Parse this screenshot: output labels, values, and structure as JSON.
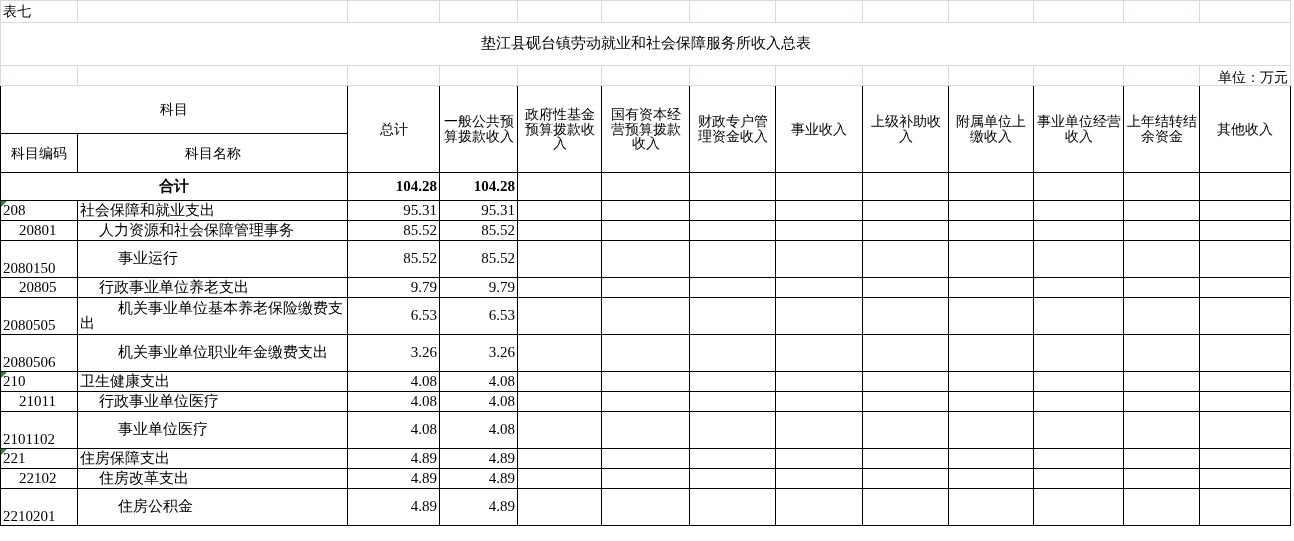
{
  "sheet_label": "表七",
  "title": "垫江县砚台镇劳动就业和社会保障服务所收入总表",
  "unit": "单位：万元",
  "table": {
    "group_header": "科目",
    "columns": [
      "科目编码",
      "科目名称",
      "总计",
      "一般公共预算拨款收入",
      "政府性基金预算拨款收入",
      "国有资本经营预算拨款收入",
      "财政专户管理资金收入",
      "事业收入",
      "上级补助收入",
      "附属单位上缴收入",
      "事业单位经营收入",
      "上年结转结余资金",
      "其他收入"
    ],
    "total_row": {
      "label": "合计",
      "values": [
        "104.28",
        "104.28"
      ]
    },
    "rows": [
      {
        "code": "208",
        "name": "社会保障和就业支出",
        "values": [
          "95.31",
          "95.31"
        ],
        "flagged": true,
        "children": [
          {
            "code": "20801",
            "name": "人力资源和社会保障管理事务",
            "values": [
              "85.52",
              "85.52"
            ],
            "flagged": false,
            "children": [
              {
                "code": "2080150",
                "name": "事业运行",
                "values": [
                  "85.52",
                  "85.52"
                ],
                "flagged": false
              }
            ]
          },
          {
            "code": "20805",
            "name": "行政事业单位养老支出",
            "values": [
              "9.79",
              "9.79"
            ],
            "flagged": false,
            "children": [
              {
                "code": "2080505",
                "name": "机关事业单位基本养老保险缴费支出",
                "values": [
                  "6.53",
                  "6.53"
                ],
                "flagged": false
              },
              {
                "code": "2080506",
                "name": "机关事业单位职业年金缴费支出",
                "values": [
                  "3.26",
                  "3.26"
                ],
                "flagged": false
              }
            ]
          }
        ]
      },
      {
        "code": "210",
        "name": "卫生健康支出",
        "values": [
          "4.08",
          "4.08"
        ],
        "flagged": true,
        "children": [
          {
            "code": "21011",
            "name": "行政事业单位医疗",
            "values": [
              "4.08",
              "4.08"
            ],
            "flagged": false,
            "children": [
              {
                "code": "2101102",
                "name": "事业单位医疗",
                "values": [
                  "4.08",
                  "4.08"
                ],
                "flagged": false
              }
            ]
          }
        ]
      },
      {
        "code": "221",
        "name": "住房保障支出",
        "values": [
          "4.89",
          "4.89"
        ],
        "flagged": true,
        "children": [
          {
            "code": "22102",
            "name": "住房改革支出",
            "values": [
              "4.89",
              "4.89"
            ],
            "flagged": false,
            "children": [
              {
                "code": "2210201",
                "name": "住房公积金",
                "values": [
                  "4.89",
                  "4.89"
                ],
                "flagged": false
              }
            ]
          }
        ]
      }
    ]
  }
}
